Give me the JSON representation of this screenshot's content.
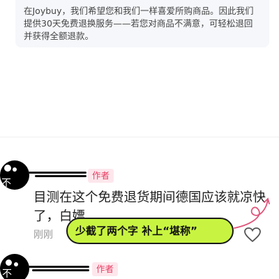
{
  "policy": {
    "text": "在Joybuy，我们希望您和我们一样喜爱所购商品。因此我们提供30天免费退换服务——若您对商品不满意，可轻松退回并获得全额退款。"
  },
  "comment1": {
    "author_badge": "作者",
    "text": "目测在这个免费退货期间德国应该就凉快了，白嫖",
    "timestamp": "刚刚",
    "annotation": "少截了两个字 补上“堪称”"
  },
  "comment2": {
    "author_badge": "作者"
  },
  "colors": {
    "badge_bg": "#fde7ec",
    "badge_text": "#e73c62",
    "annotation_bg": "#c8f441",
    "arrow": "#e0547a"
  }
}
